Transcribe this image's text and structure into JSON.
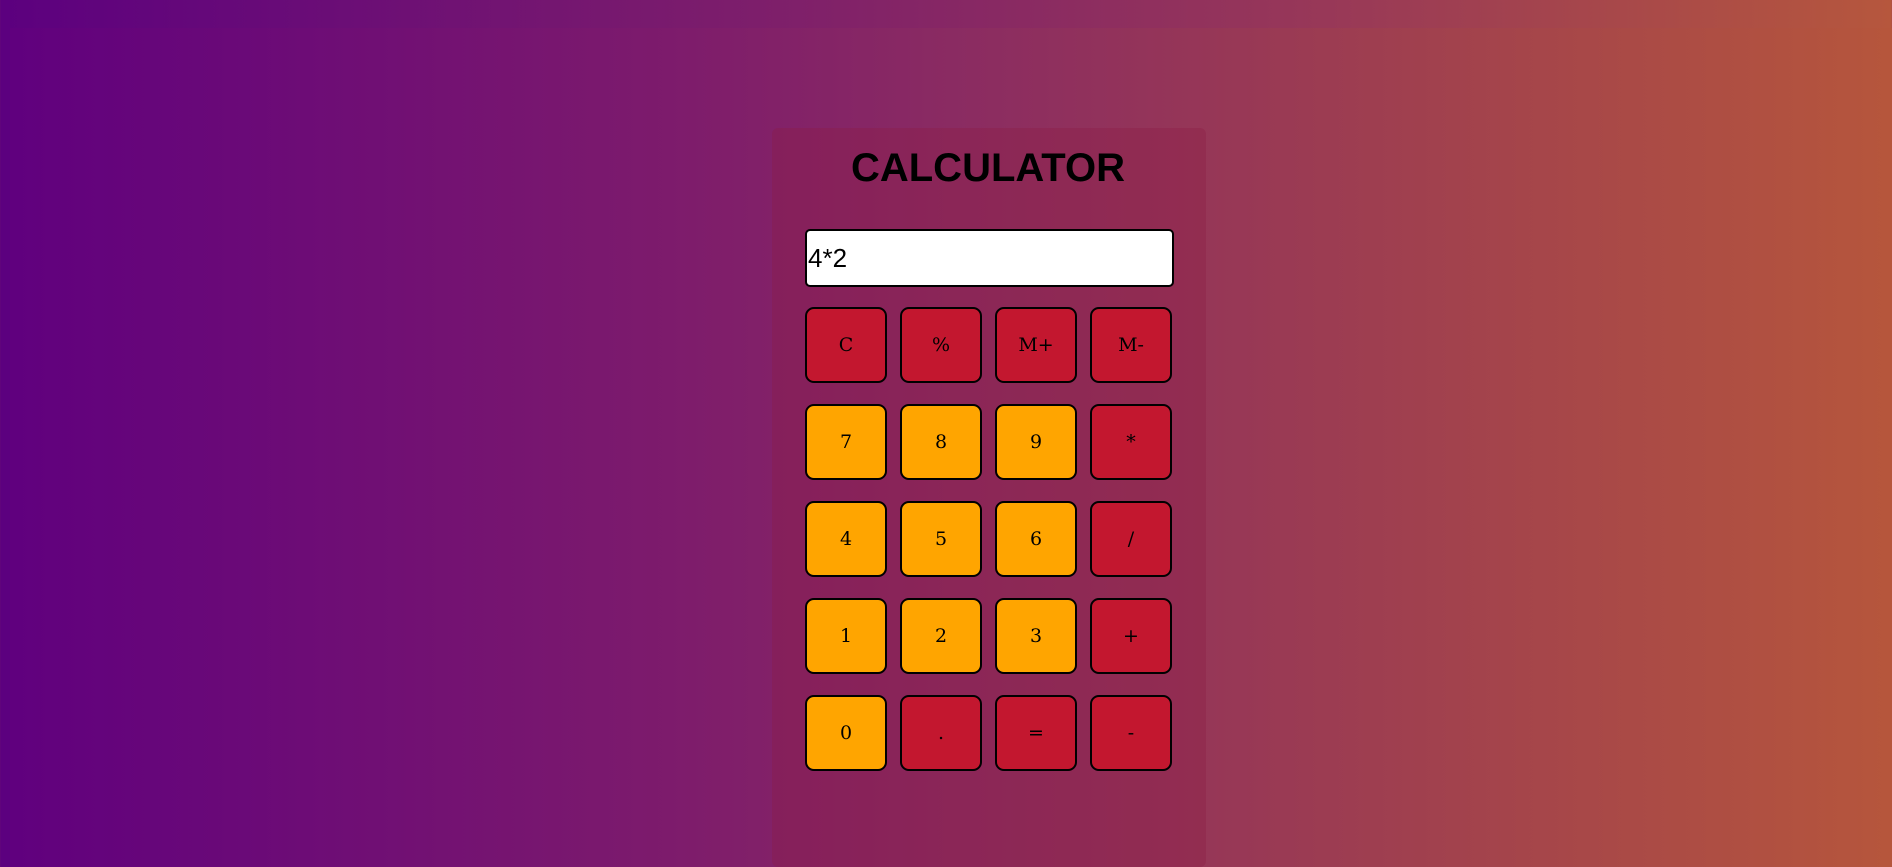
{
  "app": {
    "title": "CALCULATOR"
  },
  "display": {
    "value": "4*2"
  },
  "keys": {
    "clear": "C",
    "percent": "%",
    "memory_plus": "M+",
    "memory_minus": "M-",
    "seven": "7",
    "eight": "8",
    "nine": "9",
    "multiply": "*",
    "four": "4",
    "five": "5",
    "six": "6",
    "divide": "/",
    "one": "1",
    "two": "2",
    "three": "3",
    "add": "+",
    "zero": "0",
    "decimal": ".",
    "equals": "=",
    "subtract": "-"
  },
  "colors": {
    "operator_key": "#c3172f",
    "digit_key": "#ffa500",
    "background_start": "#5c007f",
    "background_end": "#b6573d"
  }
}
